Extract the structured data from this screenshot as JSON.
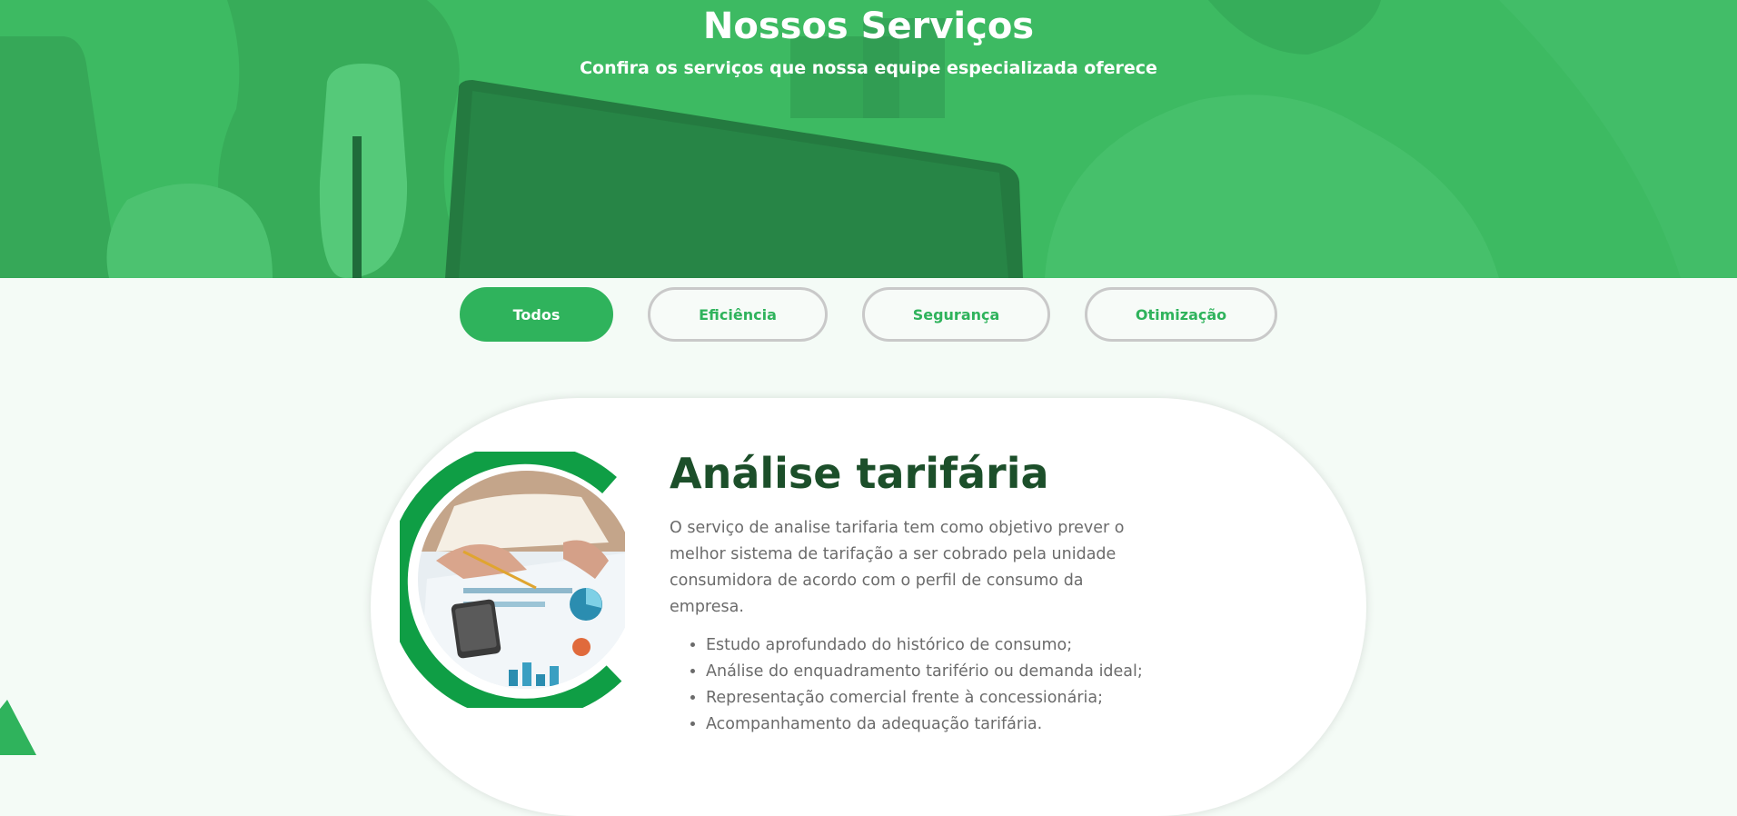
{
  "hero": {
    "title": "Nossos Serviços",
    "subtitle": "Confira os serviços que nossa equipe especializada oferece"
  },
  "filters": [
    {
      "label": "Todos",
      "active": true
    },
    {
      "label": "Eficiência",
      "active": false
    },
    {
      "label": "Segurança",
      "active": false
    },
    {
      "label": "Otimização",
      "active": false
    }
  ],
  "service": {
    "title": "Análise tarifária",
    "description": "O serviço de analise tarifaria tem como objetivo prever o melhor sistema de tarifação a ser cobrado pela unidade consumidora de acordo com o perfil de consumo da empresa.",
    "bullets": [
      "Estudo aprofundado do histórico de consumo;",
      "Análise do enquadramento tarifério ou demanda ideal;",
      "Representação comercial frente à concessionária;",
      "Acompanhamento da adequação tarifária."
    ]
  },
  "colors": {
    "brand_green": "#2fb35c",
    "hero_green": "#3dba62",
    "title_dark_green": "#1c4f2a",
    "text_gray": "#6b6b6b"
  }
}
